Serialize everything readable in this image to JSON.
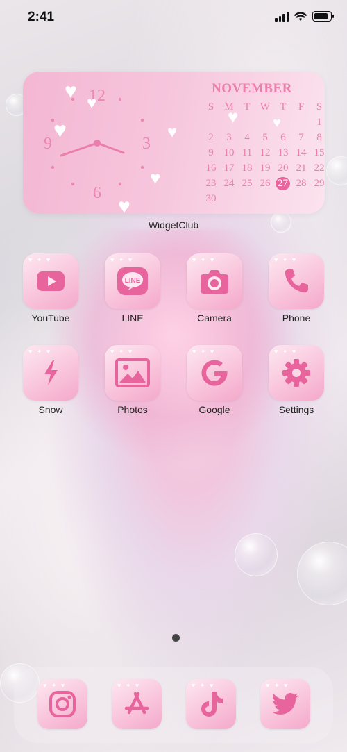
{
  "status_bar": {
    "time": "2:41"
  },
  "widget": {
    "label": "WidgetClub",
    "clock_numbers": {
      "twelve": "12",
      "three": "3",
      "six": "6",
      "nine": "9"
    },
    "calendar": {
      "month": "NOVEMBER",
      "weekdays": [
        "S",
        "M",
        "T",
        "W",
        "T",
        "F",
        "S"
      ],
      "weeks": [
        [
          "",
          "",
          "",
          "",
          "",
          "",
          "1"
        ],
        [
          "2",
          "3",
          "4",
          "5",
          "6",
          "7",
          "8"
        ],
        [
          "9",
          "10",
          "11",
          "12",
          "13",
          "14",
          "15"
        ],
        [
          "16",
          "17",
          "18",
          "19",
          "20",
          "21",
          "22"
        ],
        [
          "23",
          "24",
          "25",
          "26",
          "27",
          "28",
          "29"
        ],
        [
          "30",
          "",
          "",
          "",
          "",
          "",
          ""
        ]
      ],
      "today": "27"
    }
  },
  "apps": [
    {
      "label": "YouTube",
      "icon": "youtube-icon"
    },
    {
      "label": "LINE",
      "icon": "line-icon",
      "icon_text": "LINE"
    },
    {
      "label": "Camera",
      "icon": "camera-icon"
    },
    {
      "label": "Phone",
      "icon": "phone-icon"
    },
    {
      "label": "Snow",
      "icon": "snow-icon"
    },
    {
      "label": "Photos",
      "icon": "photos-icon"
    },
    {
      "label": "Google",
      "icon": "google-icon"
    },
    {
      "label": "Settings",
      "icon": "settings-icon"
    }
  ],
  "dock": [
    {
      "icon": "instagram-icon"
    },
    {
      "icon": "app-store-icon"
    },
    {
      "icon": "tiktok-icon"
    },
    {
      "icon": "twitter-icon"
    }
  ],
  "colors": {
    "icon_pink": "#e8649c",
    "calendar_text": "#ec7fac"
  }
}
